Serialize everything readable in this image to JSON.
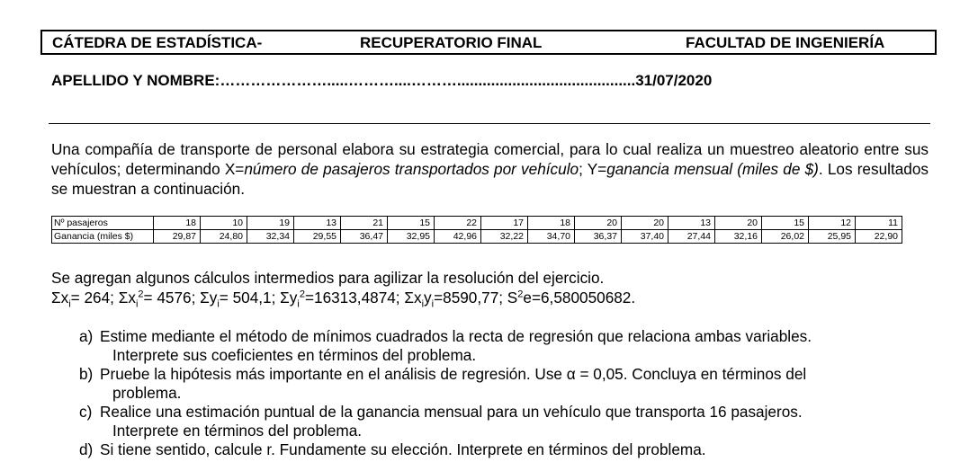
{
  "header": {
    "left": "CÁTEDRA DE ESTADÍSTICA-",
    "center": "RECUPERATORIO FINAL",
    "right": "FACULTAD DE INGENIERÍA"
  },
  "name_line": "APELLIDO Y NOMBRE:………………….....………....………..........................................31/07/2020",
  "intro": {
    "part1": "Una compañía de transporte de personal elabora su estrategia comercial, para lo cual realiza un muestreo aleatorio entre sus vehículos; determinando X=",
    "italic1": "número de pasajeros transportados por vehículo",
    "part2": "; Y=",
    "italic2": "ganancia mensual (miles de $)",
    "part3": ". Los resultados se muestran a continuación."
  },
  "table": {
    "row1_label": "Nº pasajeros",
    "row1": [
      "18",
      "10",
      "19",
      "13",
      "21",
      "15",
      "22",
      "17",
      "18",
      "20",
      "20",
      "13",
      "20",
      "15",
      "12",
      "11"
    ],
    "row2_label": "Ganancia (miles $)",
    "row2": [
      "29,87",
      "24,80",
      "32,34",
      "29,55",
      "36,47",
      "32,95",
      "42,96",
      "32,22",
      "34,70",
      "36,37",
      "37,40",
      "27,44",
      "32,16",
      "26,02",
      "25,95",
      "22,90"
    ]
  },
  "aux_title": "Se agregan algunos cálculos intermedios para agilizar la resolución del ejercicio.",
  "sums": {
    "s1": "Σx",
    "s1_sub": "i",
    "s1_val": "= 264; Σx",
    "s2_sub": "i",
    "s2_sup": "2",
    "s2_val": "= 4576; Σy",
    "s3_sub": "i",
    "s3_val": "= 504,1; Σy",
    "s4_sub": "i",
    "s4_sup": "2",
    "s4_val": "=16313,4874; Σx",
    "s5_sub": "i",
    "s5_mid": "y",
    "s5_sub2": "i",
    "s5_val": "=8590,77; S",
    "s6_sup": "2",
    "s6_val": "e=6,580050682."
  },
  "questions": [
    {
      "label": "a)",
      "line1": "Estime mediante el método de mínimos cuadrados la recta de regresión que relaciona ambas variables.",
      "line2": "Interprete sus coeficientes en términos del problema."
    },
    {
      "label": "b)",
      "line1": "Pruebe la hipótesis más importante en el análisis de regresión. Use α = 0,05. Concluya en términos del",
      "line2": "problema."
    },
    {
      "label": "c)",
      "line1": "Realice una estimación puntual de la ganancia mensual para un vehículo que transporta 16 pasajeros.",
      "line2": "Interprete en términos del problema."
    },
    {
      "label": "d)",
      "line1": "Si tiene sentido, calcule r. Fundamente su elección. Interprete en términos del problema.",
      "line2": ""
    }
  ]
}
